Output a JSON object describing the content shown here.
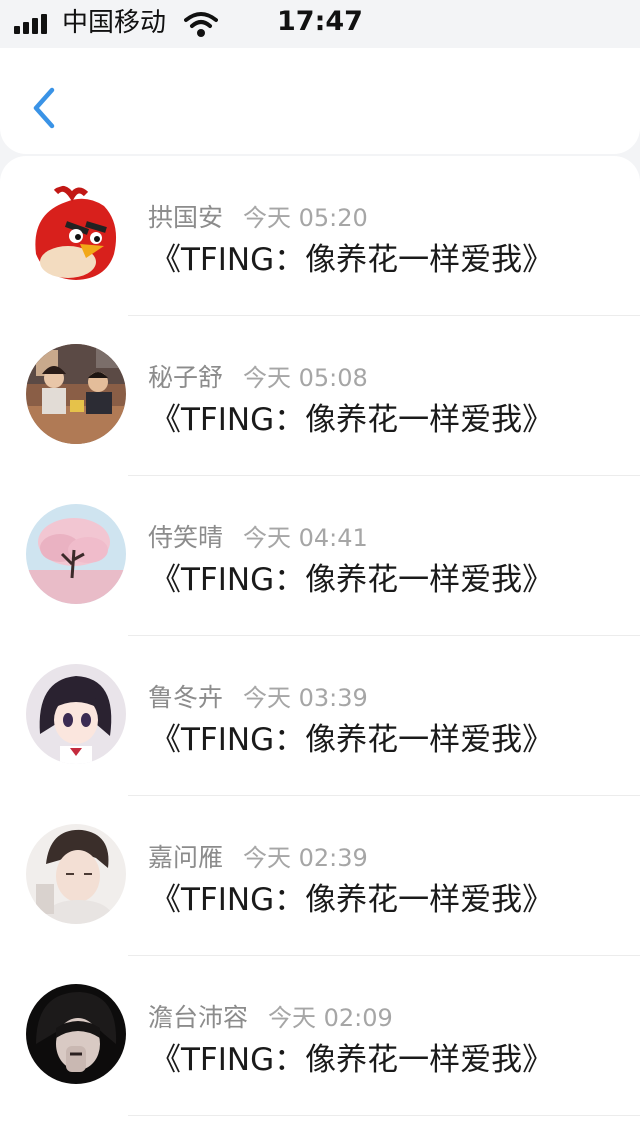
{
  "status_bar": {
    "carrier": "中国移动",
    "time": "17:47"
  },
  "nav": {
    "back_icon": "chevron-left-icon",
    "accent_color": "#3a93e6"
  },
  "messages": [
    {
      "name": "拱国安",
      "time": "今天 05:20",
      "text": "《TFING：像养花一样爱我》",
      "avatar": "red-angry-bird"
    },
    {
      "name": "秘子舒",
      "time": "今天 05:08",
      "text": "《TFING：像养花一样爱我》",
      "avatar": "photo-people-at-table"
    },
    {
      "name": "侍笑晴",
      "time": "今天 04:41",
      "text": "《TFING：像养花一样爱我》",
      "avatar": "pink-cherry-tree"
    },
    {
      "name": "鲁冬卉",
      "time": "今天 03:39",
      "text": "《TFING：像养花一样爱我》",
      "avatar": "anime-girl"
    },
    {
      "name": "嘉问雁",
      "time": "今天 02:39",
      "text": "《TFING：像养花一样爱我》",
      "avatar": "photo-portrait-light"
    },
    {
      "name": "澹台沛容",
      "time": "今天 02:09",
      "text": "《TFING：像养花一样爱我》",
      "avatar": "photo-portrait-dark"
    }
  ]
}
